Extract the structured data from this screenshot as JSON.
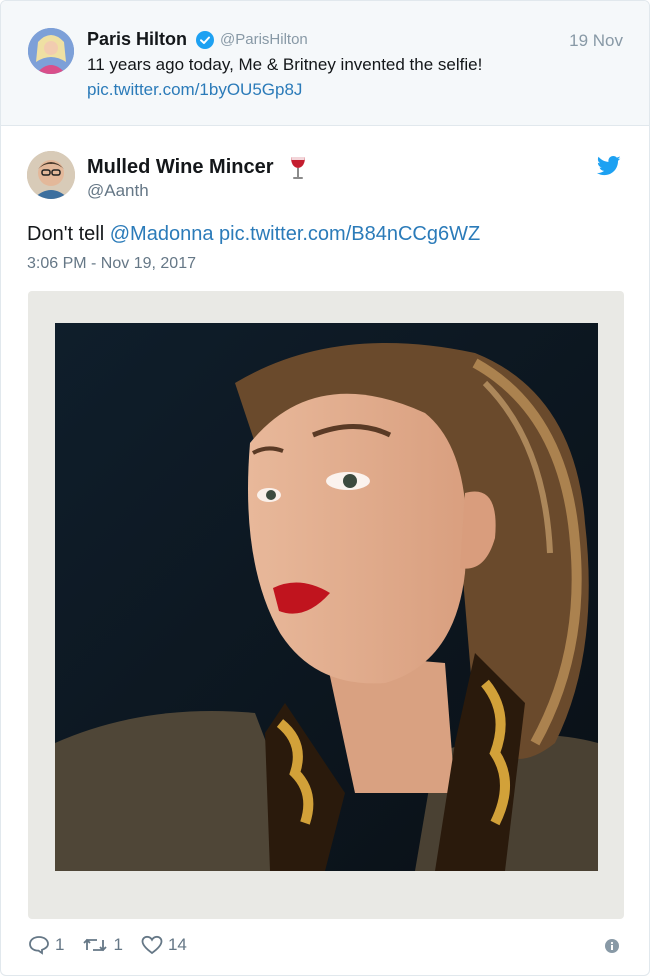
{
  "quoted": {
    "name": "Paris Hilton",
    "handle": "@ParisHilton",
    "date": "19 Nov",
    "text": "11 years ago today, Me & Britney invented the selfie!",
    "link": "pic.twitter.com/1byOU5Gp8J"
  },
  "tweet": {
    "name": "Mulled Wine Mincer",
    "emoji": "wine-glass-icon",
    "handle": "@Aanth",
    "text_prefix": "Don't tell",
    "mention": "@Madonna",
    "link": "pic.twitter.com/B84nCCg6WZ",
    "timestamp": "3:06 PM - Nov 19, 2017"
  },
  "actions": {
    "reply_count": "1",
    "retweet_count": "1",
    "like_count": "14"
  },
  "colors": {
    "link": "#2b7bb9",
    "twitter_blue": "#1da1f2",
    "muted": "#657786"
  }
}
